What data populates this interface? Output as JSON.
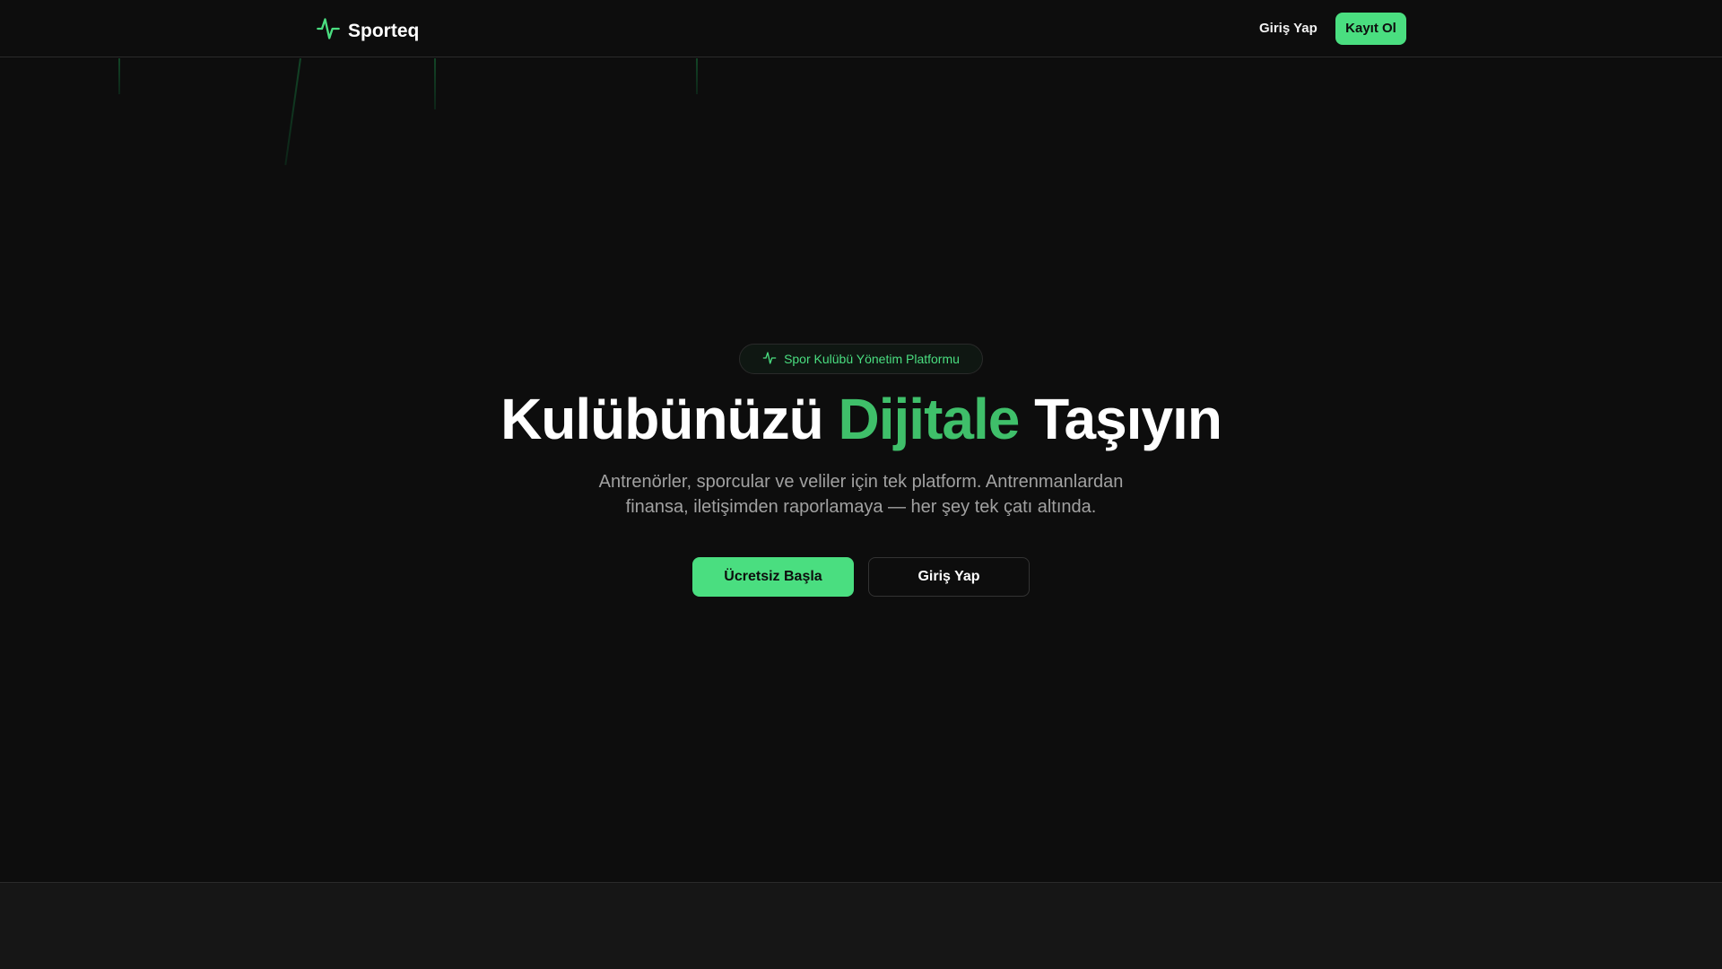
{
  "brand": {
    "name": "Sporteq",
    "icon": "activity-pulse-icon",
    "accent": "#4ade80"
  },
  "nav": {
    "login": "Giriş Yap",
    "signup": "Kayıt Ol"
  },
  "hero": {
    "badge": "Spor Kulübü Yönetim Platformu",
    "title_before": "Kulübünüzü",
    "title_accent": "Dijitale",
    "title_after": "Taşıyın",
    "subtitle_line1": "Antrenörler, sporcular ve veliler için tek platform. Antrenmanlardan",
    "subtitle_line2": "finansa, iletişimden raporlamaya — her şey tek çatı altında.",
    "primary_cta": "Ücretsiz Başla",
    "secondary_cta": "Giriş Yap"
  }
}
